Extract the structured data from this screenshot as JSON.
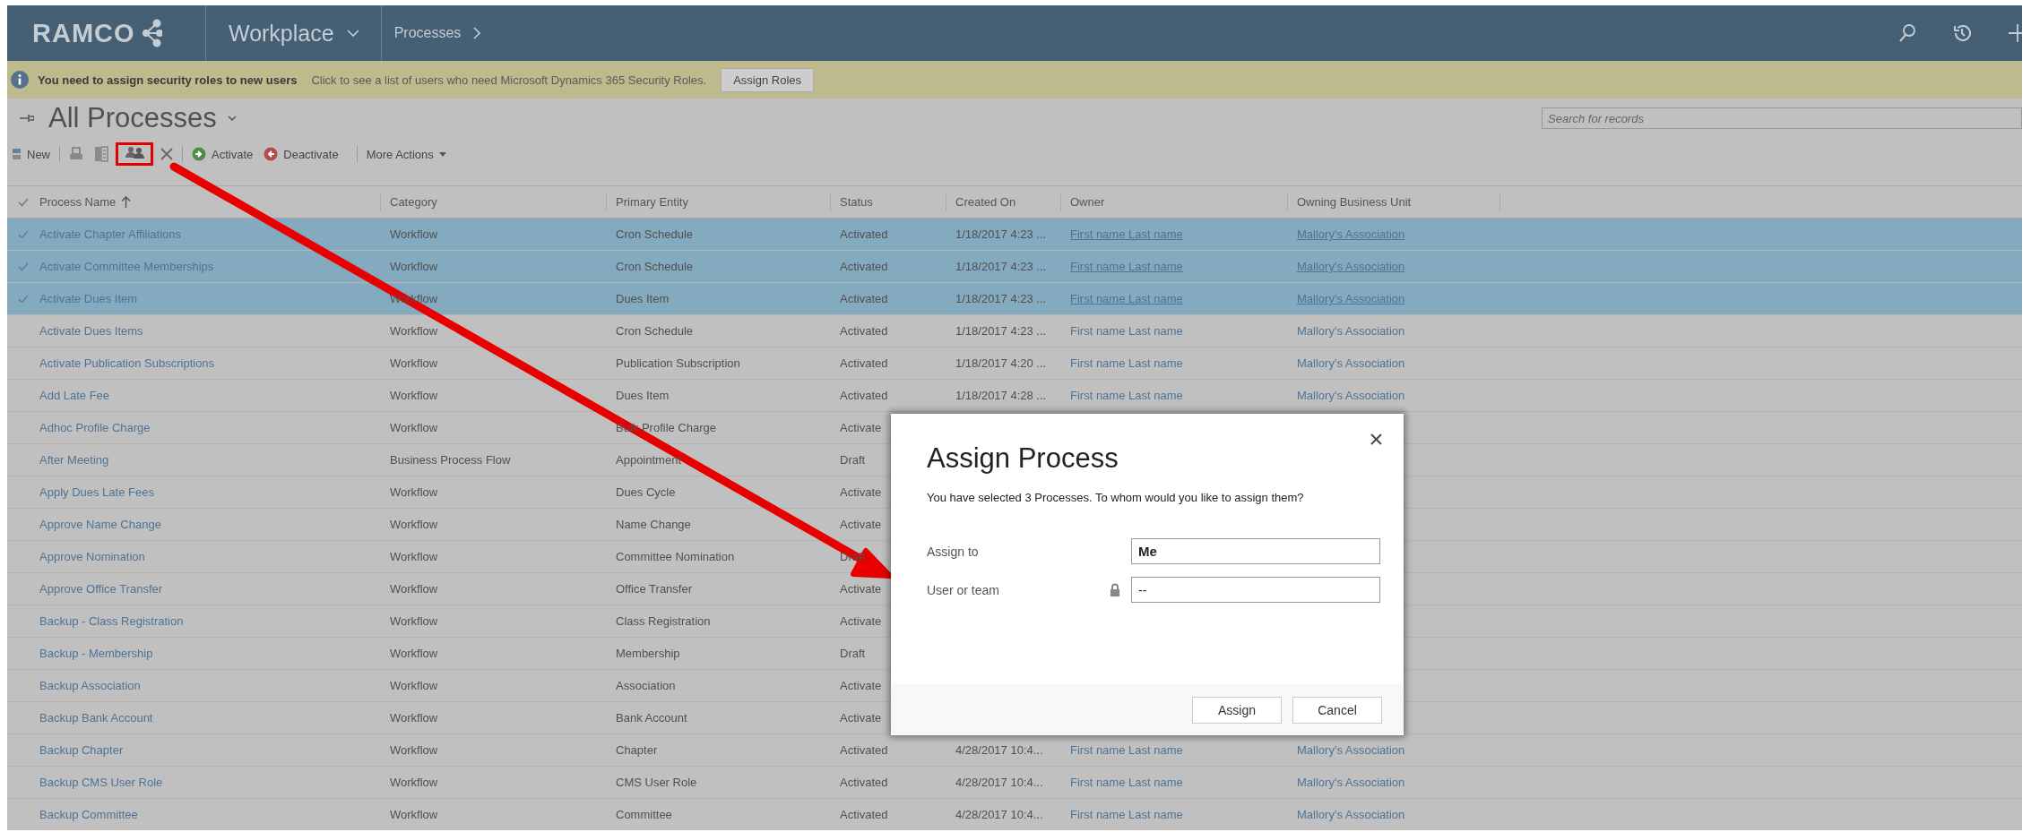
{
  "header": {
    "logo": "RAMCO",
    "app": "Workplace",
    "breadcrumb": "Processes"
  },
  "notification": {
    "title": "You need to assign security roles to new users",
    "message": "Click to see a list of users who need Microsoft Dynamics 365 Security Roles.",
    "button": "Assign Roles"
  },
  "view": {
    "title": "All Processes"
  },
  "search": {
    "placeholder": "Search for records"
  },
  "toolbar": [
    {
      "kind": "new",
      "label": "New"
    },
    {
      "kind": "activate",
      "label": "Activate"
    },
    {
      "kind": "deactivate",
      "label": "Deactivate"
    },
    {
      "kind": "menu",
      "label": "More Actions"
    }
  ],
  "table": {
    "columns": [
      "Process Name",
      "Category",
      "Primary Entity",
      "Status",
      "Created On",
      "Owner",
      "Owning Business Unit"
    ],
    "rows": [
      {
        "selected": true,
        "name": "Activate Chapter Affiliations",
        "category": "Workflow",
        "entity": "Cron Schedule",
        "status": "Activated",
        "created": "1/18/2017 4:23 ...",
        "owner": "First name Last name",
        "unit": "Mallory's Association"
      },
      {
        "selected": true,
        "name": "Activate Committee Memberships",
        "category": "Workflow",
        "entity": "Cron Schedule",
        "status": "Activated",
        "created": "1/18/2017 4:23 ...",
        "owner": "First name Last name",
        "unit": "Mallory's Association"
      },
      {
        "selected": true,
        "name": "Activate Dues Item",
        "category": "Workflow",
        "entity": "Dues Item",
        "status": "Activated",
        "created": "1/18/2017 4:23 ...",
        "owner": "First name Last name",
        "unit": "Mallory's Association"
      },
      {
        "selected": false,
        "name": "Activate Dues Items",
        "category": "Workflow",
        "entity": "Cron Schedule",
        "status": "Activated",
        "created": "1/18/2017 4:23 ...",
        "owner": "First name Last name",
        "unit": "Mallory's Association"
      },
      {
        "selected": false,
        "name": "Activate Publication Subscriptions",
        "category": "Workflow",
        "entity": "Publication Subscription",
        "status": "Activated",
        "created": "1/18/2017 4:20 ...",
        "owner": "First name Last name",
        "unit": "Mallory's Association"
      },
      {
        "selected": false,
        "name": "Add Late Fee",
        "category": "Workflow",
        "entity": "Dues Item",
        "status": "Activated",
        "created": "1/18/2017 4:28 ...",
        "owner": "First name Last name",
        "unit": "Mallory's Association"
      },
      {
        "selected": false,
        "name": "Adhoc Profile Charge",
        "category": "Workflow",
        "entity": "Bulk Profile Charge",
        "status": "Activate"
      },
      {
        "selected": false,
        "name": "After Meeting",
        "category": "Business Process Flow",
        "entity": "Appointment",
        "status": "Draft"
      },
      {
        "selected": false,
        "name": "Apply Dues Late Fees",
        "category": "Workflow",
        "entity": "Dues Cycle",
        "status": "Activate"
      },
      {
        "selected": false,
        "name": "Approve Name Change",
        "category": "Workflow",
        "entity": "Name Change",
        "status": "Activate"
      },
      {
        "selected": false,
        "name": "Approve Nomination",
        "category": "Workflow",
        "entity": "Committee Nomination",
        "status": "Draft"
      },
      {
        "selected": false,
        "name": "Approve Office Transfer",
        "category": "Workflow",
        "entity": "Office Transfer",
        "status": "Activate"
      },
      {
        "selected": false,
        "name": "Backup - Class Registration",
        "category": "Workflow",
        "entity": "Class Registration",
        "status": "Activate"
      },
      {
        "selected": false,
        "name": "Backup - Membership",
        "category": "Workflow",
        "entity": "Membership",
        "status": "Draft"
      },
      {
        "selected": false,
        "name": "Backup Association",
        "category": "Workflow",
        "entity": "Association",
        "status": "Activate"
      },
      {
        "selected": false,
        "name": "Backup Bank Account",
        "category": "Workflow",
        "entity": "Bank Account",
        "status": "Activate"
      },
      {
        "selected": false,
        "name": "Backup Chapter",
        "category": "Workflow",
        "entity": "Chapter",
        "status": "Activated",
        "created": "4/28/2017 10:4...",
        "owner": "First name Last name",
        "unit": "Mallory's Association"
      },
      {
        "selected": false,
        "name": "Backup CMS User Role",
        "category": "Workflow",
        "entity": "CMS User Role",
        "status": "Activated",
        "created": "4/28/2017 10:4...",
        "owner": "First name Last name",
        "unit": "Mallory's Association"
      },
      {
        "selected": false,
        "name": "Backup Committee",
        "category": "Workflow",
        "entity": "Committee",
        "status": "Activated",
        "created": "4/28/2017 10:4...",
        "owner": "First name Last name",
        "unit": "Mallory's Association"
      }
    ]
  },
  "dialog": {
    "title": "Assign Process",
    "message": "You have selected 3 Processes. To whom would you like to assign them?",
    "fields": [
      {
        "label": "Assign to",
        "value": "Me",
        "locked": false
      },
      {
        "label": "User or team",
        "value": "--",
        "locked": true
      }
    ],
    "buttons": [
      "Assign",
      "Cancel"
    ]
  }
}
